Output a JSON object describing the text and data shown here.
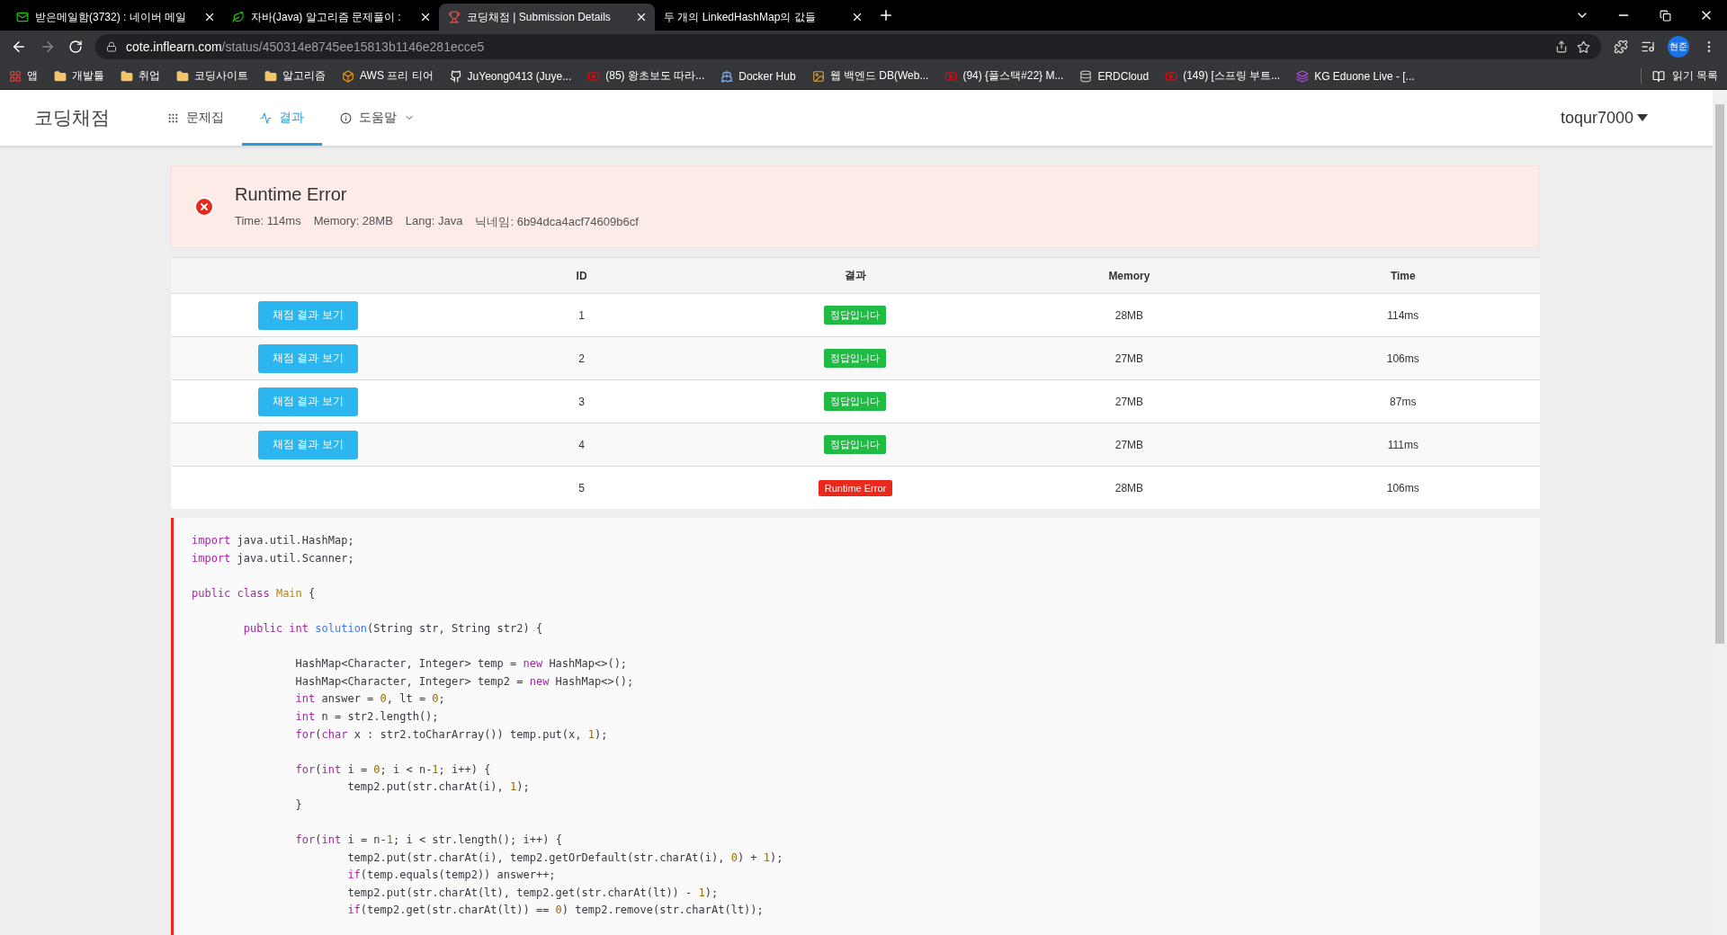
{
  "browser": {
    "tabs": [
      {
        "title": "받은메일함(3732) : 네이버 메일",
        "selected": false
      },
      {
        "title": "자바(Java) 알고리즘 문제풀이 :",
        "selected": false
      },
      {
        "title": "코딩채점 | Submission Details",
        "selected": true
      },
      {
        "title": "두 개의 LinkedHashMap의 값들",
        "selected": false
      }
    ],
    "url": {
      "host": "cote.inflearn.com",
      "path": "/status/450314e8745ee15813b1146e281ecce5"
    },
    "profile": "현준",
    "bookmarks": [
      "앱",
      "개발툴",
      "취업",
      "코딩사이트",
      "알고리즘",
      "AWS 프리 티어",
      "JuYeong0413 (Juye...",
      "(85) 왕초보도 따라...",
      "Docker Hub",
      "웹 백엔드 DB(Web...",
      "(94) {풀스택#22} M...",
      "ERDCloud",
      "(149) [스프링 부트...",
      "KG Eduone Live - [..."
    ],
    "reading_list": "읽기 목록"
  },
  "nav": {
    "brand": "코딩채점",
    "items": [
      {
        "label": "문제집",
        "selected": false,
        "dropdown": false
      },
      {
        "label": "결과",
        "selected": true,
        "dropdown": false
      },
      {
        "label": "도움말",
        "selected": false,
        "dropdown": true
      }
    ],
    "user": "toqur7000"
  },
  "result": {
    "title": "Runtime Error",
    "meta": [
      "Time: 114ms",
      "Memory: 28MB",
      "Lang: Java",
      "닉네임: 6b94dca4acf74609b6cf"
    ]
  },
  "table": {
    "columns": [
      "ID",
      "결과",
      "Memory",
      "Time"
    ],
    "rows": [
      {
        "button": "채점 결과 보기",
        "id": "1",
        "result": {
          "text": "정답입니다",
          "kind": "success"
        },
        "memory": "28MB",
        "time": "114ms"
      },
      {
        "button": "채점 결과 보기",
        "id": "2",
        "result": {
          "text": "정답입니다",
          "kind": "success"
        },
        "memory": "27MB",
        "time": "106ms"
      },
      {
        "button": "채점 결과 보기",
        "id": "3",
        "result": {
          "text": "정답입니다",
          "kind": "success"
        },
        "memory": "27MB",
        "time": "87ms"
      },
      {
        "button": "채점 결과 보기",
        "id": "4",
        "result": {
          "text": "정답입니다",
          "kind": "success"
        },
        "memory": "27MB",
        "time": "111ms"
      },
      {
        "id": "5",
        "result": {
          "text": "Runtime Error",
          "kind": "error"
        },
        "memory": "28MB",
        "time": "106ms"
      }
    ]
  },
  "code": [
    {
      "kind": "code",
      "parts": [
        {
          "kind": "keyword",
          "t": "import"
        },
        {
          "kind": "plain",
          "t": " java.util.HashMap;"
        }
      ]
    },
    {
      "kind": "code",
      "parts": [
        {
          "kind": "keyword",
          "t": "import"
        },
        {
          "kind": "plain",
          "t": " java.util.Scanner;"
        }
      ]
    },
    {
      "kind": "blank"
    },
    {
      "kind": "code",
      "parts": [
        {
          "kind": "keyword",
          "t": "public class "
        },
        {
          "kind": "class",
          "t": "Main"
        },
        {
          "kind": "plain",
          "t": " {"
        }
      ]
    },
    {
      "kind": "blank"
    },
    {
      "kind": "code",
      "parts": [
        {
          "kind": "keyword",
          "t": "        public int "
        },
        {
          "kind": "function",
          "t": "solution"
        },
        {
          "kind": "plain",
          "t": "(String str, String str2) {"
        }
      ]
    },
    {
      "kind": "blank"
    },
    {
      "kind": "code",
      "parts": [
        {
          "kind": "plain",
          "t": "                HashMap<Character, Integer> temp = "
        },
        {
          "kind": "keyword",
          "t": "new"
        },
        {
          "kind": "plain",
          "t": " HashMap<>();"
        }
      ]
    },
    {
      "kind": "code",
      "parts": [
        {
          "kind": "plain",
          "t": "                HashMap<Character, Integer> temp2 = "
        },
        {
          "kind": "keyword",
          "t": "new"
        },
        {
          "kind": "plain",
          "t": " HashMap<>();"
        }
      ]
    },
    {
      "kind": "code",
      "parts": [
        {
          "kind": "keyword",
          "t": "                int"
        },
        {
          "kind": "plain",
          "t": " answer = "
        },
        {
          "kind": "number",
          "t": "0"
        },
        {
          "kind": "plain",
          "t": ", lt = "
        },
        {
          "kind": "number",
          "t": "0"
        },
        {
          "kind": "plain",
          "t": ";"
        }
      ]
    },
    {
      "kind": "code",
      "parts": [
        {
          "kind": "keyword",
          "t": "                int"
        },
        {
          "kind": "plain",
          "t": " n = str2.length();"
        }
      ]
    },
    {
      "kind": "code",
      "parts": [
        {
          "kind": "keyword",
          "t": "                for"
        },
        {
          "kind": "plain",
          "t": "("
        },
        {
          "kind": "keyword",
          "t": "char"
        },
        {
          "kind": "plain",
          "t": " x : str2.toCharArray()) temp.put(x, "
        },
        {
          "kind": "number",
          "t": "1"
        },
        {
          "kind": "plain",
          "t": ");"
        }
      ]
    },
    {
      "kind": "blank"
    },
    {
      "kind": "code",
      "parts": [
        {
          "kind": "keyword",
          "t": "                for"
        },
        {
          "kind": "plain",
          "t": "("
        },
        {
          "kind": "keyword",
          "t": "int"
        },
        {
          "kind": "plain",
          "t": " i = "
        },
        {
          "kind": "number",
          "t": "0"
        },
        {
          "kind": "plain",
          "t": "; i < n-"
        },
        {
          "kind": "number",
          "t": "1"
        },
        {
          "kind": "plain",
          "t": "; i++) {"
        }
      ]
    },
    {
      "kind": "code",
      "parts": [
        {
          "kind": "plain",
          "t": "                        temp2.put(str.charAt(i), "
        },
        {
          "kind": "number",
          "t": "1"
        },
        {
          "kind": "plain",
          "t": ");"
        }
      ]
    },
    {
      "kind": "code",
      "parts": [
        {
          "kind": "plain",
          "t": "                }"
        }
      ]
    },
    {
      "kind": "blank"
    },
    {
      "kind": "code",
      "parts": [
        {
          "kind": "keyword",
          "t": "                for"
        },
        {
          "kind": "plain",
          "t": "("
        },
        {
          "kind": "keyword",
          "t": "int"
        },
        {
          "kind": "plain",
          "t": " i = n-"
        },
        {
          "kind": "number",
          "t": "1"
        },
        {
          "kind": "plain",
          "t": "; i < str.length(); i++) {"
        }
      ]
    },
    {
      "kind": "code",
      "parts": [
        {
          "kind": "plain",
          "t": "                        temp2.put(str.charAt(i), temp2.getOrDefault(str.charAt(i), "
        },
        {
          "kind": "number",
          "t": "0"
        },
        {
          "kind": "plain",
          "t": ") + "
        },
        {
          "kind": "number",
          "t": "1"
        },
        {
          "kind": "plain",
          "t": ");"
        }
      ]
    },
    {
      "kind": "code",
      "parts": [
        {
          "kind": "keyword",
          "t": "                        if"
        },
        {
          "kind": "plain",
          "t": "(temp.equals(temp2)) answer++;"
        }
      ]
    },
    {
      "kind": "code",
      "parts": [
        {
          "kind": "plain",
          "t": "                        temp2.put(str.charAt(lt), temp2.get(str.charAt(lt)) - "
        },
        {
          "kind": "number",
          "t": "1"
        },
        {
          "kind": "plain",
          "t": ");"
        }
      ]
    },
    {
      "kind": "code",
      "parts": [
        {
          "kind": "keyword",
          "t": "                        if"
        },
        {
          "kind": "plain",
          "t": "(temp2.get(str.charAt(lt)) == "
        },
        {
          "kind": "number",
          "t": "0"
        },
        {
          "kind": "plain",
          "t": ") temp2.remove(str.charAt(lt));"
        }
      ]
    }
  ]
}
